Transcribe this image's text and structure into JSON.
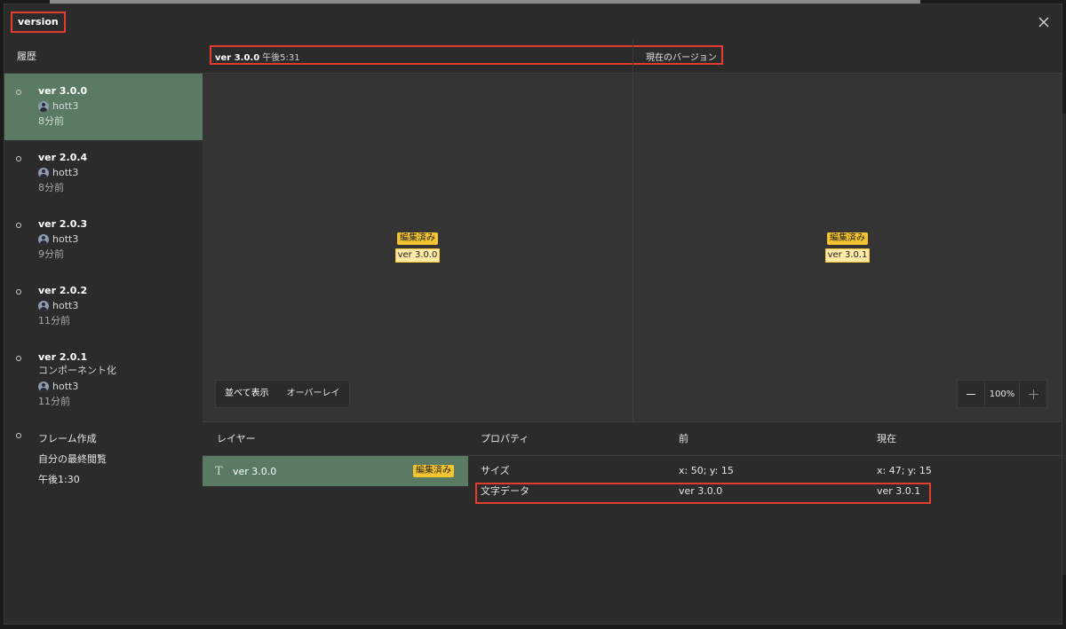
{
  "modal": {
    "title": "version"
  },
  "sidebar": {
    "header": "履歴",
    "items": [
      {
        "version": "ver 3.0.0",
        "desc": "",
        "user": "hott3",
        "time": "8分前"
      },
      {
        "version": "ver 2.0.4",
        "desc": "",
        "user": "hott3",
        "time": "8分前"
      },
      {
        "version": "ver 2.0.3",
        "desc": "",
        "user": "hott3",
        "time": "9分前"
      },
      {
        "version": "ver 2.0.2",
        "desc": "",
        "user": "hott3",
        "time": "11分前"
      },
      {
        "version": "ver 2.0.1",
        "desc": "コンポーネント化",
        "user": "hott3",
        "time": "11分前"
      }
    ],
    "frame": {
      "title": "フレーム作成",
      "last_viewed": "自分の最終閲覧",
      "time": "午後1:30"
    }
  },
  "compare": {
    "left_version": "ver 3.0.0",
    "left_time": "午後5:31",
    "right_label": "現在のバージョン",
    "left_badge": "編集済み",
    "left_value": "ver 3.0.0",
    "right_badge": "編集済み",
    "right_value": "ver 3.0.1",
    "view_side": "並べて表示",
    "view_overlay": "オーバーレイ",
    "zoom": "100%"
  },
  "layers": {
    "header": "レイヤー",
    "row_name": "ver 3.0.0",
    "row_badge": "編集済み"
  },
  "props": {
    "col_property": "プロパティ",
    "col_before": "前",
    "col_current": "現在",
    "rows": [
      {
        "name": "サイズ",
        "before": "x: 50; y: 15",
        "current": "x: 47; y: 15"
      },
      {
        "name": "文字データ",
        "before": "ver 3.0.0",
        "current": "ver 3.0.1"
      }
    ]
  },
  "colors": {
    "accent_green": "#5a7a64",
    "badge_yellow": "#f4c430",
    "highlight_red": "#e53d2d"
  }
}
